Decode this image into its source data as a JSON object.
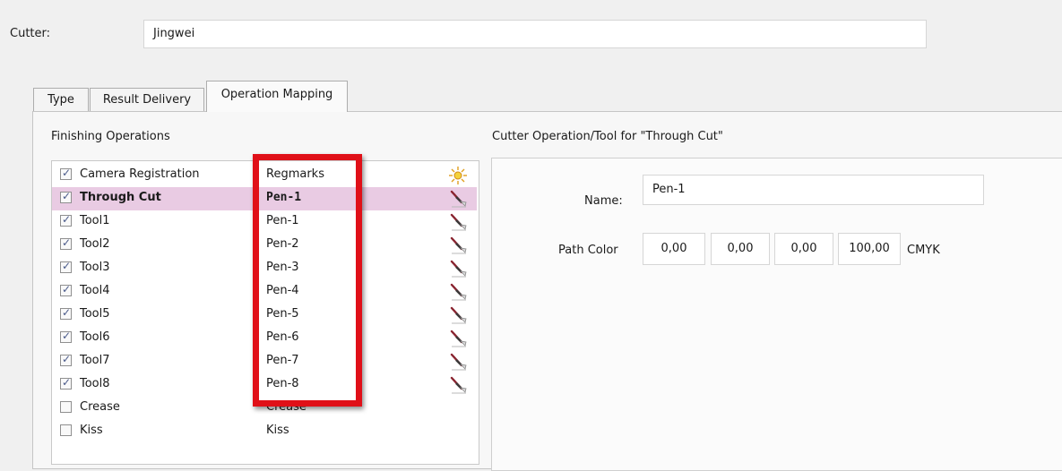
{
  "cutter": {
    "label": "Cutter:",
    "value": "Jingwei"
  },
  "tabs": [
    {
      "label": "Type"
    },
    {
      "label": "Result Delivery"
    },
    {
      "label": "Operation Mapping"
    }
  ],
  "finishing": {
    "heading": "Finishing Operations",
    "rows": [
      {
        "name": "Camera Registration",
        "tool": "Regmarks",
        "checked": true,
        "icon": "camera-sun-icon"
      },
      {
        "name": "Through Cut",
        "tool": "Pen-1",
        "checked": true,
        "selected": true,
        "icon": "pen-tool-icon"
      },
      {
        "name": "Tool1",
        "tool": "Pen-1",
        "checked": true,
        "icon": "pen-tool-icon"
      },
      {
        "name": "Tool2",
        "tool": "Pen-2",
        "checked": true,
        "icon": "pen-tool-icon"
      },
      {
        "name": "Tool3",
        "tool": "Pen-3",
        "checked": true,
        "icon": "pen-tool-icon"
      },
      {
        "name": "Tool4",
        "tool": "Pen-4",
        "checked": true,
        "icon": "pen-tool-icon"
      },
      {
        "name": "Tool5",
        "tool": "Pen-5",
        "checked": true,
        "icon": "pen-tool-icon"
      },
      {
        "name": "Tool6",
        "tool": "Pen-6",
        "checked": true,
        "icon": "pen-tool-icon"
      },
      {
        "name": "Tool7",
        "tool": "Pen-7",
        "checked": true,
        "icon": "pen-tool-icon"
      },
      {
        "name": "Tool8",
        "tool": "Pen-8",
        "checked": true,
        "icon": "pen-tool-icon"
      },
      {
        "name": "Crease",
        "tool": "Crease",
        "checked": false
      },
      {
        "name": "Kiss",
        "tool": "Kiss",
        "checked": false
      }
    ]
  },
  "detail": {
    "heading": "Cutter Operation/Tool for \"Through Cut\"",
    "name_label": "Name:",
    "name_value": "Pen-1",
    "path_color_label": "Path Color",
    "cmyk": [
      "0,00",
      "0,00",
      "0,00",
      "100,00"
    ],
    "cmyk_label": "CMYK"
  },
  "colors": {
    "selected_row": "#e9cbe3",
    "highlight_border": "#e01018"
  }
}
